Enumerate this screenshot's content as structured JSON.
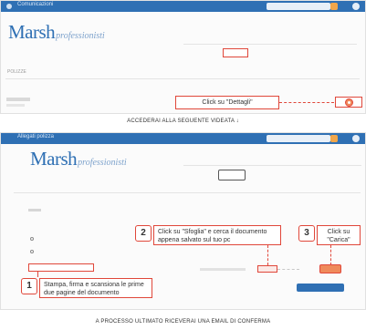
{
  "screen1": {
    "window_title": "Comunicazioni",
    "logo_main": "Marsh",
    "logo_sub": "professionisti",
    "section_label": "POLIZZE",
    "callout_text": "Click su \"Dettagli\""
  },
  "caption1": "ACCEDERAI ALLA SEGUENTE VIDEATA ↓",
  "screen2": {
    "window_title": "Allegati polizza",
    "logo_main": "Marsh",
    "logo_sub": "professionisti",
    "step1_number": "1",
    "step1_text": "Stampa, firma e scansiona le prime due pagine del documento",
    "step2_number": "2",
    "step2_text": "Click su \"Sfoglia\" e cerca il documento appena salvato sul tuo pc",
    "step3_number": "3",
    "step3_text": "Click su \"Carica\""
  },
  "caption2": "A PROCESSO ULTIMATO RICEVERAI UNA EMAIL DI CONFERMA",
  "colors": {
    "accent": "#2f70b4",
    "highlight": "#e0473a",
    "action": "#ef8a5b"
  }
}
